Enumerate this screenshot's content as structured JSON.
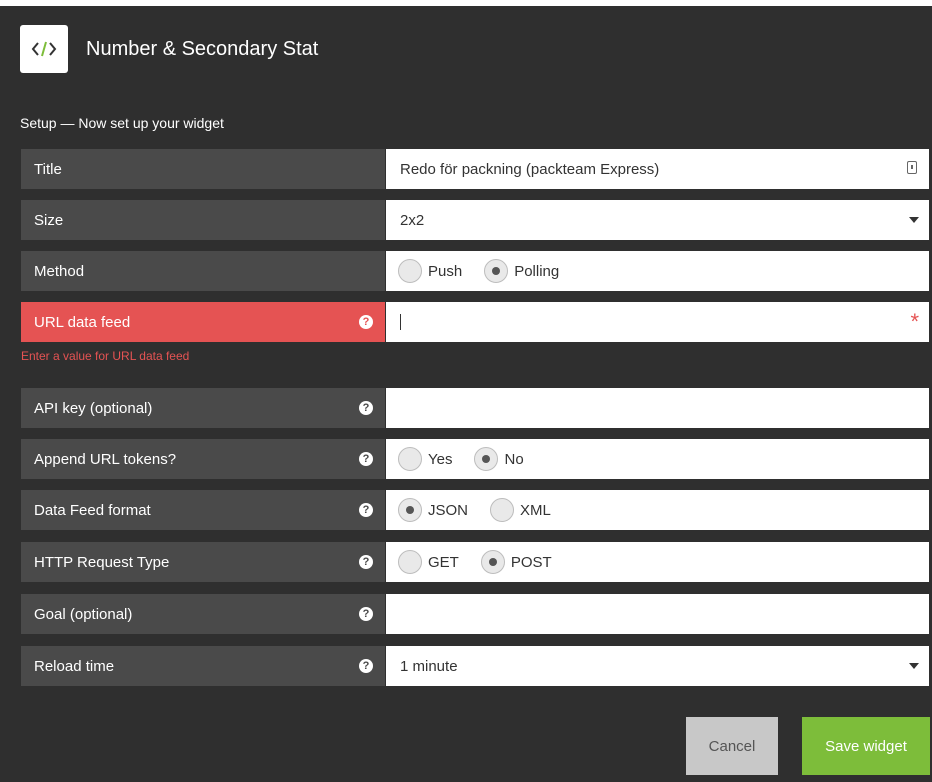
{
  "header": {
    "icon": "code-icon",
    "title": "Number & Secondary Stat"
  },
  "setup": {
    "subtitle": "Setup — Now set up your widget"
  },
  "form": {
    "title": {
      "label": "Title",
      "value": "Redo för packning (packteam Express)"
    },
    "size": {
      "label": "Size",
      "value": "2x2"
    },
    "method": {
      "label": "Method",
      "options": [
        "Push",
        "Polling"
      ],
      "selected": "Polling"
    },
    "url": {
      "label": "URL data feed",
      "value": "",
      "required_mark": "*",
      "error": "Enter a value for URL data feed"
    },
    "api_key": {
      "label": "API key (optional)",
      "value": ""
    },
    "append_tokens": {
      "label": "Append URL tokens?",
      "options": [
        "Yes",
        "No"
      ],
      "selected": "No"
    },
    "format": {
      "label": "Data Feed format",
      "options": [
        "JSON",
        "XML"
      ],
      "selected": "JSON"
    },
    "request_type": {
      "label": "HTTP Request Type",
      "options": [
        "GET",
        "POST"
      ],
      "selected": "POST"
    },
    "goal": {
      "label": "Goal (optional)",
      "value": ""
    },
    "reload": {
      "label": "Reload time",
      "value": "1 minute"
    }
  },
  "help_glyph": "?",
  "buttons": {
    "cancel": "Cancel",
    "save": "Save widget"
  },
  "colors": {
    "background": "#2f2f2f",
    "label_bg": "#4a4a4a",
    "error": "#e55353",
    "save": "#7dbd3a",
    "cancel": "#c8c8c8"
  }
}
